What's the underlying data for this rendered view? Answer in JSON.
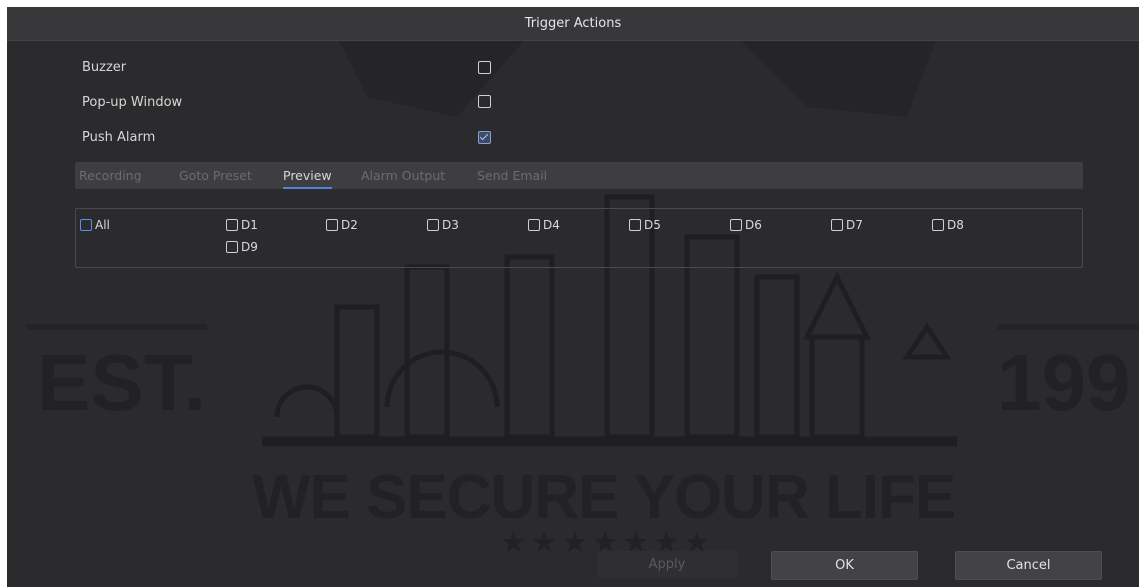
{
  "dialog": {
    "title": "Trigger Actions"
  },
  "actions": [
    {
      "label": "Buzzer",
      "checked": false
    },
    {
      "label": "Pop-up Window",
      "checked": false
    },
    {
      "label": "Push Alarm",
      "checked": true
    }
  ],
  "tabs": [
    {
      "label": "Recording",
      "active": false
    },
    {
      "label": "Goto Preset",
      "active": false
    },
    {
      "label": "Preview",
      "active": true
    },
    {
      "label": "Alarm Output",
      "active": false
    },
    {
      "label": "Send Email",
      "active": false
    }
  ],
  "channels": {
    "all_label": "All",
    "items": [
      "D1",
      "D2",
      "D3",
      "D4",
      "D5",
      "D6",
      "D7",
      "D8",
      "D9"
    ]
  },
  "watermark": {
    "left_text": "EST.",
    "right_text": "199",
    "slogan": "WE SECURE YOUR LIFE",
    "stars": "★ ★ ★ ★ ★ ★ ★"
  },
  "buttons": {
    "apply": "Apply",
    "ok": "OK",
    "cancel": "Cancel"
  },
  "colors": {
    "accent": "#4f82d8",
    "background": "#2b2b2d"
  }
}
